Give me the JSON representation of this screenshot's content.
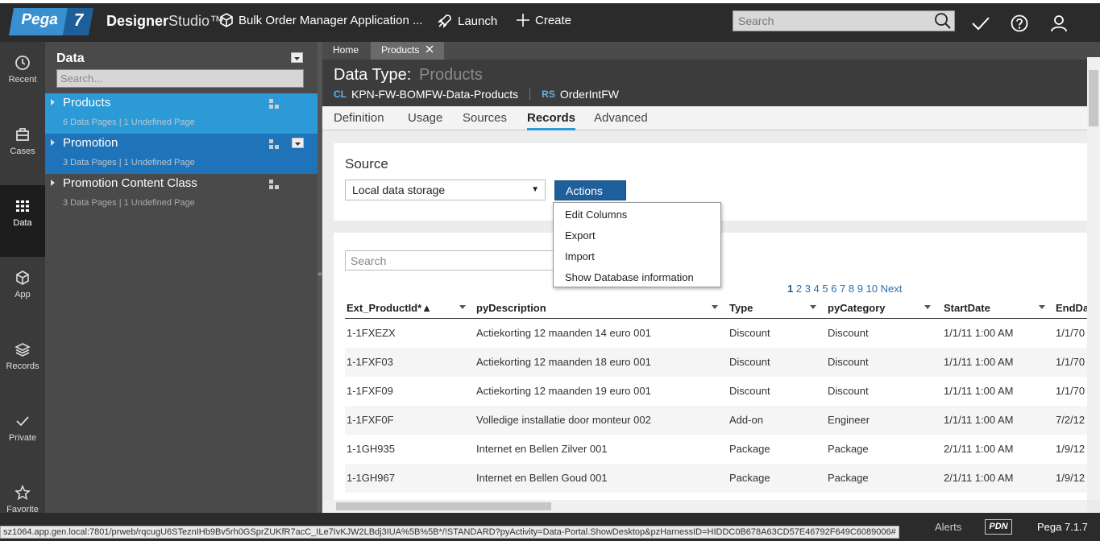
{
  "topbar": {
    "logo_pega": "Pega",
    "logo_version": "7",
    "studio_bold": "Designer",
    "studio_light": "Studio™",
    "app_name": "Bulk Order Manager Application ...",
    "launch_label": "Launch",
    "create_label": "Create",
    "search_placeholder": "Search"
  },
  "rail": {
    "items": [
      {
        "label": "Recent",
        "icon": "clock-icon"
      },
      {
        "label": "Cases",
        "icon": "briefcase-icon"
      },
      {
        "label": "Data",
        "icon": "grid-icon"
      },
      {
        "label": "App",
        "icon": "cube-icon"
      },
      {
        "label": "Records",
        "icon": "layers-icon"
      },
      {
        "label": "Private",
        "icon": "check-icon"
      },
      {
        "label": "Favorite",
        "icon": "star-icon"
      }
    ]
  },
  "explorer": {
    "title": "Data",
    "search_placeholder": "Search...",
    "items": [
      {
        "name": "Products",
        "meta": "6 Data Pages  |  1 Undefined Page"
      },
      {
        "name": "Promotion",
        "meta": "3 Data Pages  |  1 Undefined Page"
      },
      {
        "name": "Promotion Content Class",
        "meta": "3 Data Pages  |  1 Undefined Page"
      }
    ]
  },
  "doctabs": {
    "home": "Home",
    "products": "Products"
  },
  "header": {
    "label": "Data Type:",
    "name": "Products",
    "cl_tag": "CL",
    "cl_value": "KPN-FW-BOMFW-Data-Products",
    "rs_tag": "RS",
    "rs_value": "OrderIntFW"
  },
  "subtabs": [
    "Definition",
    "Usage",
    "Sources",
    "Records",
    "Advanced"
  ],
  "source": {
    "title": "Source",
    "selected": "Local data storage",
    "actions_label": "Actions ▼"
  },
  "menu": [
    "Edit Columns",
    "Export",
    "Import",
    "Show Database information"
  ],
  "grid": {
    "search_placeholder": "Search",
    "pager_current": "1",
    "pager_rest": "2 3 4 5 6 7 8 9 10 Next",
    "columns": [
      "Ext_ProductId*▲",
      "pyDescription",
      "Type",
      "pyCategory",
      "StartDate",
      "EndDa"
    ],
    "rows": [
      [
        "1-1FXEZX",
        "Actiekorting 12 maanden 14 euro 001",
        "Discount",
        "Discount",
        "1/1/11 1:00 AM",
        "1/1/70"
      ],
      [
        "1-1FXF03",
        "Actiekorting 12 maanden 18 euro 001",
        "Discount",
        "Discount",
        "1/1/11 1:00 AM",
        "1/1/70"
      ],
      [
        "1-1FXF09",
        "Actiekorting 12 maanden 19 euro 001",
        "Discount",
        "Discount",
        "1/1/11 1:00 AM",
        "1/1/70"
      ],
      [
        "1-1FXF0F",
        "Volledige installatie door monteur 002",
        "Add-on",
        "Engineer",
        "1/1/11 1:00 AM",
        "7/2/12"
      ],
      [
        "1-1GH935",
        "Internet en Bellen Zilver 001",
        "Package",
        "Package",
        "2/1/11 1:00 AM",
        "1/9/12"
      ],
      [
        "1-1GH967",
        "Internet en Bellen Goud 001",
        "Package",
        "Package",
        "2/1/11 1:00 AM",
        "1/9/12"
      ]
    ]
  },
  "footer": {
    "status_url": "sz1064.app.gen.local:7801/prweb/rqcugU6STeznIHb9Bv5rh0GSprZUKfR7acC_ILe7IvKJW2LBdj3IUA%5B%5B*/!STANDARD?pyActivity=Data-Portal.ShowDesktop&pzHarnessID=HIDDC0B678A63CD57E46792F649C6089006#",
    "alerts": "Alerts",
    "pdn": "PDN",
    "version": "Pega 7.1.7"
  },
  "colors": {
    "topbar": "#2b2b2b",
    "accent": "#2b9ad7",
    "selected_item": "#1f73b8",
    "actions_button": "#1f5f9c"
  }
}
